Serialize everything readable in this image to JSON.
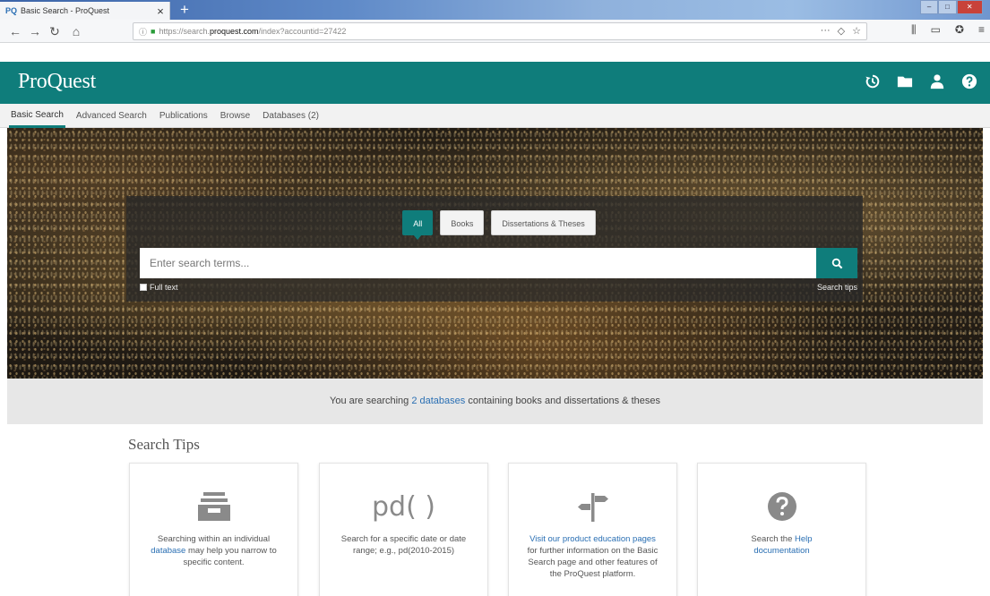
{
  "browser": {
    "tab_title": "Basic Search - ProQuest",
    "tab_close": "×",
    "new_tab": "+",
    "url_prefix": "https://search.",
    "url_domain": "proquest.com",
    "url_path": "/index?accountid=27422",
    "url_more": "···",
    "win_minimize": "–",
    "win_maximize": "□",
    "win_close": "✕"
  },
  "header": {
    "logo": "ProQuest"
  },
  "subnav": {
    "items": [
      {
        "label": "Basic Search"
      },
      {
        "label": "Advanced Search"
      },
      {
        "label": "Publications"
      },
      {
        "label": "Browse"
      },
      {
        "label": "Databases (2)"
      }
    ]
  },
  "search": {
    "filters": [
      {
        "label": "All"
      },
      {
        "label": "Books"
      },
      {
        "label": "Dissertations & Theses"
      }
    ],
    "placeholder": "Enter search terms...",
    "fulltext_label": "Full text",
    "tips_link": "Search tips"
  },
  "infobar": {
    "prefix": "You are searching ",
    "link": "2 databases",
    "suffix": " containing books and dissertations & theses"
  },
  "tips": {
    "title": "Search Tips",
    "cards": [
      {
        "icon": "inbox-tray-icon",
        "before": "Searching within an individual ",
        "link": "database",
        "after": " may help you narrow to specific content."
      },
      {
        "icon": "pd-function-icon",
        "glyph": "pd( )",
        "before": "Search for a specific date or date range; e.g., pd(2010-2015)",
        "link": "",
        "after": ""
      },
      {
        "icon": "signpost-icon",
        "before": "",
        "link": "Visit our product education pages",
        "after": " for further information on the Basic Search page and other features of the ProQuest platform."
      },
      {
        "icon": "help-circle-icon",
        "before": "Search the ",
        "link": "Help",
        "after": " documentation"
      }
    ]
  },
  "colors": {
    "brand": "#0f7d7b",
    "link": "#2a6fb3"
  }
}
